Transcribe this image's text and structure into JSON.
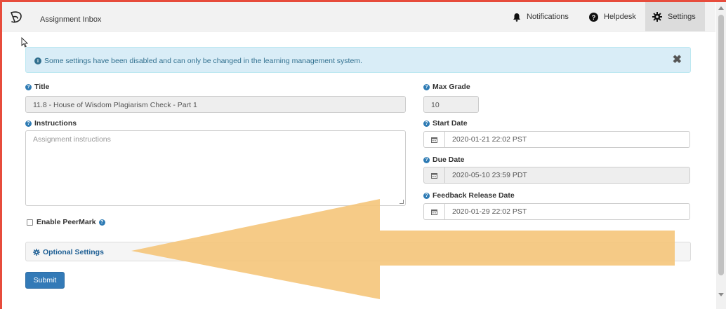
{
  "nav": {
    "app_title": "Assignment Inbox",
    "notifications": "Notifications",
    "helpdesk": "Helpdesk",
    "settings": "Settings"
  },
  "alert": {
    "message": "Some settings have been disabled and can only be changed in the learning management system.",
    "close": "✖"
  },
  "form": {
    "title_label": "Title",
    "title_value": "11.8 - House of Wisdom Plagiarism Check - Part 1",
    "instructions_label": "Instructions",
    "instructions_placeholder": "Assignment instructions",
    "max_grade_label": "Max Grade",
    "max_grade_value": "10",
    "start_date_label": "Start Date",
    "start_date_value": "2020-01-21 22:02 PST",
    "due_date_label": "Due Date",
    "due_date_value": "2020-05-10 23:59 PDT",
    "feedback_date_label": "Feedback Release Date",
    "feedback_date_value": "2020-01-29 22:02 PST",
    "peermark_label": "Enable PeerMark",
    "optional_settings": "Optional Settings",
    "submit": "Submit"
  },
  "colors": {
    "accent": "#337ab7",
    "alert_bg": "#d9edf7",
    "annotation_arrow": "#f5c57a",
    "frame_border": "#e74c3c"
  },
  "icons": [
    "logo-icon",
    "bell-icon",
    "question-circle-icon",
    "gear-icon",
    "info-icon",
    "close-icon",
    "calendar-icon",
    "cog-icon",
    "cursor-icon",
    "arrow-annotation"
  ]
}
